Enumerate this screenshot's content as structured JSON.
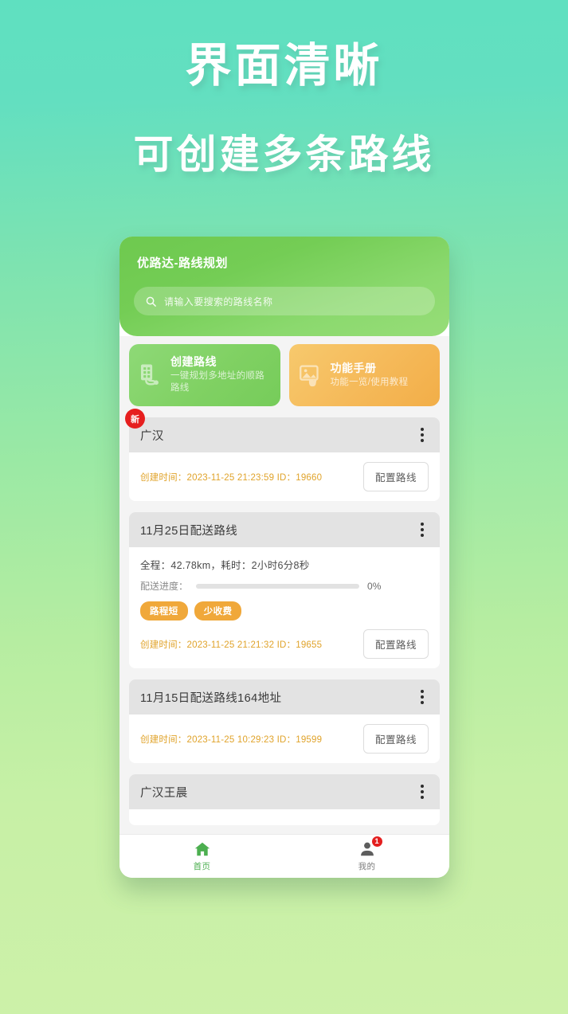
{
  "promo": {
    "line1": "界面清晰",
    "line2": "可创建多条路线"
  },
  "app": {
    "title": "优路达-路线规划",
    "search": {
      "placeholder": "请输入要搜索的路线名称",
      "value": "",
      "icon": "search-icon"
    },
    "quick_actions": [
      {
        "title": "创建路线",
        "subtitle": "一键规划多地址的顺路路线",
        "icon": "route-building-icon",
        "color": "#7ccf5e"
      },
      {
        "title": "功能手册",
        "subtitle": "功能一览/使用教程",
        "icon": "manual-image-icon",
        "color": "#f4b755"
      }
    ],
    "routes": [
      {
        "name": "广汉",
        "badge": "新",
        "has_stats": false,
        "created_label": "创建时间：",
        "created_time": "2023-11-25 21:23:59",
        "id_label": "ID：",
        "id": "19660",
        "action_label": "配置路线",
        "menu_icon": "more-vertical-icon"
      },
      {
        "name": "11月25日配送路线",
        "badge": "",
        "has_stats": true,
        "stats": "全程：42.78km，耗时：2小时6分8秒",
        "distance": "42.78km",
        "duration": "2小时6分8秒",
        "progress_label": "配送进度：",
        "progress_pct": "0%",
        "progress_value": 0,
        "tags": [
          "路程短",
          "少收费"
        ],
        "created_label": "创建时间：",
        "created_time": "2023-11-25 21:21:32",
        "id_label": "ID：",
        "id": "19655",
        "action_label": "配置路线",
        "menu_icon": "more-vertical-icon"
      },
      {
        "name": "11月15日配送路线164地址",
        "badge": "",
        "has_stats": false,
        "created_label": "创建时间：",
        "created_time": "2023-11-25 10:29:23",
        "id_label": "ID：",
        "id": "19599",
        "action_label": "配置路线",
        "menu_icon": "more-vertical-icon"
      },
      {
        "name": "广汉王晨",
        "badge": "",
        "has_stats": false,
        "menu_icon": "more-vertical-icon"
      }
    ],
    "bottom_nav": [
      {
        "label": "首页",
        "icon": "home-icon",
        "active": true,
        "badge": ""
      },
      {
        "label": "我的",
        "icon": "user-icon",
        "active": false,
        "badge": "1"
      }
    ]
  },
  "meta_row_1": {
    "text": "创建时间：2023-11-25 21:23:59  ID：19660"
  },
  "meta_row_2": {
    "text": "创建时间：2023-11-25 21:21:32  ID：19655"
  },
  "meta_row_3": {
    "text": "创建时间：2023-11-25 10:29:23  ID：19599"
  },
  "colors": {
    "background_top": "#5fe0c0",
    "background_bottom": "#cdf1a9",
    "header_green": "#7ccf5e",
    "accent_orange": "#f0a83a",
    "meta_gold": "#e0a32a",
    "badge_red": "#e61f1f",
    "nav_active": "#4caf50"
  }
}
